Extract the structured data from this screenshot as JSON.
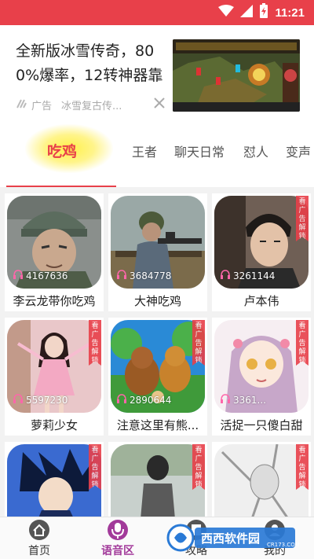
{
  "status_bar": {
    "time": "11:21",
    "accent": "#e8404a"
  },
  "ad": {
    "title": "全新版冰雪传奇，800%爆率，12转神器靠",
    "tag": "广告",
    "source": "冰雪复古传...",
    "close_icon": "close-icon"
  },
  "tabs": [
    {
      "label": "吃鸡",
      "active": true
    },
    {
      "label": "王者"
    },
    {
      "label": "聊天日常"
    },
    {
      "label": "怼人"
    },
    {
      "label": "变声"
    }
  ],
  "cards": [
    {
      "name": "李云龙带你吃鸡",
      "count": "4167636",
      "ribbon": ""
    },
    {
      "name": "大神吃鸡",
      "count": "3684778",
      "ribbon": ""
    },
    {
      "name": "卢本伟",
      "count": "3261144",
      "ribbon": "看广告解锁"
    },
    {
      "name": "萝莉少女",
      "count": "5597230",
      "ribbon": "看广告解锁"
    },
    {
      "name": "注意这里有熊...",
      "count": "2890644",
      "ribbon": "看广告解锁"
    },
    {
      "name": "活捉一只傻白甜",
      "count": "3361...",
      "ribbon": "看广告解锁"
    },
    {
      "name": "",
      "count": "",
      "ribbon": "看广告解锁"
    },
    {
      "name": "",
      "count": "",
      "ribbon": "看广告解锁"
    },
    {
      "name": "",
      "count": "",
      "ribbon": "看广告解锁"
    }
  ],
  "bottom_nav": [
    {
      "label": "首页",
      "icon": "home-icon"
    },
    {
      "label": "语音区",
      "icon": "microphone-icon",
      "active": true
    },
    {
      "label": "攻略",
      "icon": "guide-icon"
    },
    {
      "label": "我的",
      "icon": "profile-icon"
    }
  ],
  "watermark": {
    "brand": "西西软件园",
    "url": "CR173.COM"
  }
}
